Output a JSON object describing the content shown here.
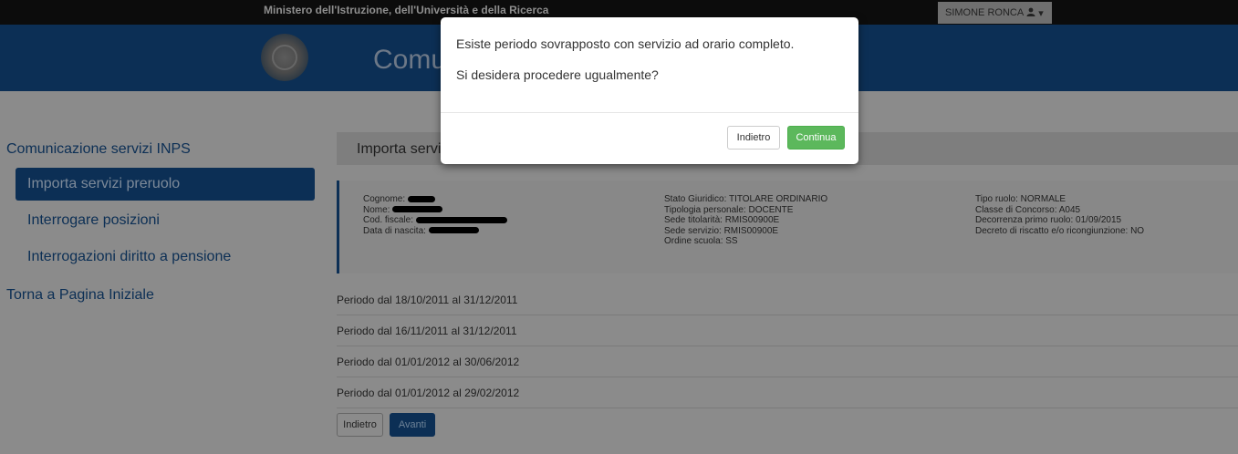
{
  "header": {
    "ministry": "Ministero dell'Istruzione, dell'Università e della Ricerca",
    "user_name": "SIMONE RONCA",
    "user_icon": "user-icon",
    "app_title": "Comu"
  },
  "sidebar": {
    "title": "Comunicazione servizi INPS",
    "items": [
      {
        "label": "Importa servizi preruolo",
        "active": true
      },
      {
        "label": "Interrogare posizioni",
        "active": false
      },
      {
        "label": "Interrogazioni diritto a pensione",
        "active": false
      }
    ],
    "home_link": "Torna a Pagina Iniziale"
  },
  "content": {
    "header_title": "Importa servi",
    "info": {
      "col1": {
        "cognome_label": "Cognome:",
        "nome_label": "Nome:",
        "cf_label": "Cod. fiscale:",
        "nascita_label": "Data di nascita:"
      },
      "col2": {
        "stato": "Stato Giuridico: TITOLARE ORDINARIO",
        "tipologia": "Tipologia personale: DOCENTE",
        "sede_titolarita": "Sede titolarità: RMIS00900E",
        "sede_servizio": "Sede servizio: RMIS00900E",
        "ordine": "Ordine scuola: SS"
      },
      "col3": {
        "tipo_ruolo": "Tipo ruolo: NORMALE",
        "classe": "Classe di Concorso: A045",
        "decorrenza": "Decorrenza primo ruolo: 01/09/2015",
        "decreto": "Decreto di riscatto e/o ricongiunzione: NO"
      }
    },
    "periods": [
      "Periodo dal 18/10/2011 al 31/12/2011",
      "Periodo dal 16/11/2011 al 31/12/2011",
      "Periodo dal 01/01/2012 al 30/06/2012",
      "Periodo dal 01/01/2012 al 29/02/2012"
    ],
    "back_label": "Indietro",
    "next_label": "Avanti"
  },
  "modal": {
    "message_line1": "Esiste periodo sovrapposto con servizio ad orario completo.",
    "message_line2": "Si desidera procedere ugualmente?",
    "cancel_label": "Indietro",
    "continue_label": "Continua"
  },
  "colors": {
    "primary": "#0c2f55",
    "success": "#5cb85c"
  }
}
